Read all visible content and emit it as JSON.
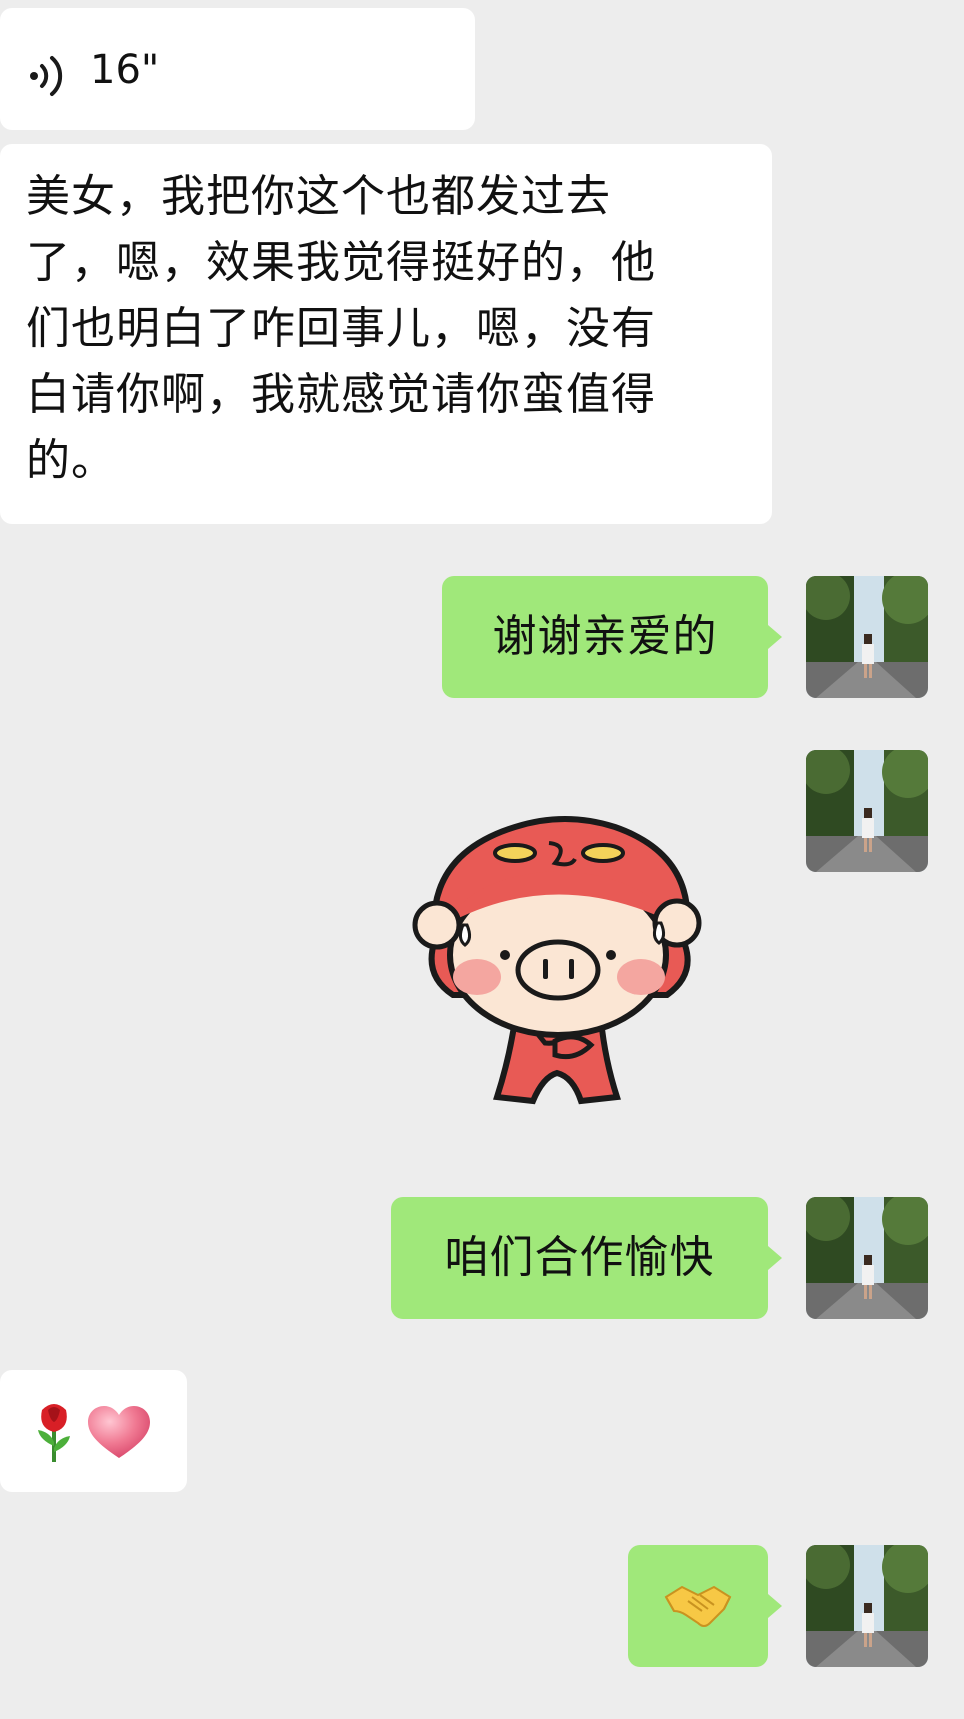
{
  "messages": [
    {
      "id": "m1",
      "side": "incoming",
      "type": "voice",
      "duration": "16\""
    },
    {
      "id": "m2",
      "side": "incoming",
      "type": "text",
      "lines": [
        "美女，我把你这个也都发过去",
        "了，嗯，效果我觉得挺好的，他",
        "们也明白了咋回事儿，嗯，没有",
        "白请你啊，我就感觉请你蛮值得",
        "的。"
      ]
    },
    {
      "id": "m3",
      "side": "outgoing",
      "type": "text",
      "text": "谢谢亲爱的"
    },
    {
      "id": "m4",
      "side": "outgoing",
      "type": "sticker",
      "sticker": "red-hooded-pig-sticker"
    },
    {
      "id": "m5",
      "side": "outgoing",
      "type": "text",
      "text": "咱们合作愉快"
    },
    {
      "id": "m6",
      "side": "incoming",
      "type": "emoji",
      "emojis": [
        "rose-emoji",
        "heart-emoji"
      ]
    },
    {
      "id": "m7",
      "side": "outgoing",
      "type": "emoji",
      "emojis": [
        "handshake-emoji"
      ]
    }
  ],
  "colors": {
    "background": "#ededed",
    "incoming_bubble": "#ffffff",
    "outgoing_bubble": "#a0e87a"
  },
  "icons": {
    "voice": "voice-wave-icon",
    "avatar": "user-avatar-road-photo"
  }
}
